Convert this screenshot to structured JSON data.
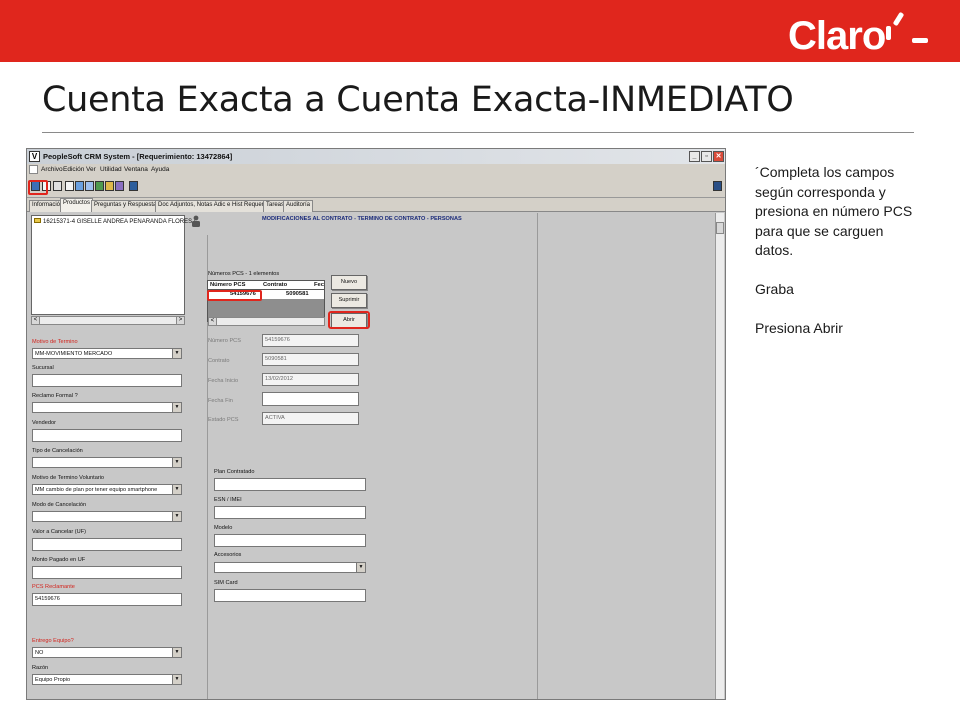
{
  "slide": {
    "title": "Cuenta Exacta a Cuenta Exacta-INMEDIATO",
    "brand": "Claro",
    "instructions": [
      "´Completa los campos según corresponda y presiona en número PCS para que se carguen datos.",
      "Graba",
      "Presiona Abrir"
    ],
    "colors": {
      "brand_red": "#e0261d"
    }
  },
  "app": {
    "window_title": "PeopleSoft CRM System - [Requerimiento: 13472864]",
    "window_buttons": {
      "minimize": "_",
      "maximize": "▫",
      "close": "✕"
    },
    "menu": [
      "Archivo",
      "Edición",
      "Ver",
      "Utilidad",
      "Ventana",
      "Ayuda"
    ],
    "tabs": [
      "Información",
      "Productos",
      "Preguntas y Respuestas",
      "Doc Adjuntos, Notas Adic e Hist Requerim",
      "Tareas",
      "Auditoría"
    ],
    "active_tab": "Productos",
    "tree_item": "16215371-4 GISELLE ANDREA PENARANDA FLORES /",
    "section_title": "MODIFICACIONES AL CONTRATO - TERMINO DE CONTRATO - PERSONAS",
    "left_form": [
      {
        "label": "Motivo de Termino",
        "value": "MM-MOVIMIENTO MERCADO",
        "required": true,
        "dropdown": true
      },
      {
        "label": "Sucursal",
        "value": "",
        "required": false,
        "dropdown": false
      },
      {
        "label": "Reclamo Formal ?",
        "value": "",
        "required": false,
        "dropdown": true
      },
      {
        "label": "Vendedor",
        "value": "",
        "required": false,
        "dropdown": false
      },
      {
        "label": "Tipo de Cancelación",
        "value": "",
        "required": false,
        "dropdown": true
      },
      {
        "label": "Motivo de Termino Voluntario",
        "value": "MM cambio de plan por tener equipo smartphone",
        "required": false,
        "dropdown": true
      },
      {
        "label": "Modo de Cancelación",
        "value": "",
        "required": false,
        "dropdown": true
      },
      {
        "label": "Valor a Cancelar (UF)",
        "value": "",
        "required": false,
        "dropdown": false
      },
      {
        "label": "Monto Pagado en UF",
        "value": "",
        "required": false,
        "dropdown": false
      },
      {
        "label": "PCS Reclamante",
        "value": "54159676",
        "required": true,
        "dropdown": false
      },
      {
        "label": "Entrego Equipo?",
        "value": "NO",
        "required": true,
        "dropdown": true
      },
      {
        "label": "Razón",
        "value": "Equipo Propio",
        "required": false,
        "dropdown": true
      }
    ],
    "pcs_grid": {
      "caption": "Números PCS - 1 elementos",
      "headers": [
        "Número PCS",
        "Contrato",
        "Fec"
      ],
      "row": [
        "54159676",
        "5090581",
        ""
      ]
    },
    "buttons": {
      "nuevo": "Nuevo",
      "suprimir": "Suprimir",
      "abrir": "Abrir"
    },
    "detail_fields": [
      {
        "label": "Número PCS",
        "value": "54159676"
      },
      {
        "label": "Contrato",
        "value": "5090581"
      },
      {
        "label": "Fecha Inicio",
        "value": "13/02/2012"
      },
      {
        "label": "Fecha Fin",
        "value": ""
      },
      {
        "label": "Estado PCS",
        "value": "ACTIVA"
      }
    ],
    "lower_fields": [
      {
        "label": "Plan Contratado",
        "value": "",
        "dropdown": false
      },
      {
        "label": "ESN / IMEI",
        "value": "",
        "dropdown": false
      },
      {
        "label": "Modelo",
        "value": "",
        "dropdown": false
      },
      {
        "label": "Accesorios",
        "value": "",
        "dropdown": true
      },
      {
        "label": "SIM Card",
        "value": "",
        "dropdown": false
      }
    ]
  }
}
